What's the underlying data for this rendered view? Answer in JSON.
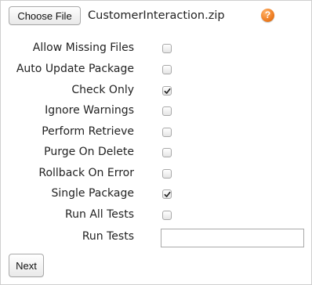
{
  "upload": {
    "choose_file_label": "Choose File",
    "file_name": "CustomerInteraction.zip",
    "help_glyph": "?"
  },
  "options": [
    {
      "label": "Allow Missing Files",
      "checked": false
    },
    {
      "label": "Auto Update Package",
      "checked": false
    },
    {
      "label": "Check Only",
      "checked": true
    },
    {
      "label": "Ignore Warnings",
      "checked": false
    },
    {
      "label": "Perform Retrieve",
      "checked": false
    },
    {
      "label": "Purge On Delete",
      "checked": false
    },
    {
      "label": "Rollback On Error",
      "checked": false
    },
    {
      "label": "Single Package",
      "checked": true
    },
    {
      "label": "Run All Tests",
      "checked": false
    }
  ],
  "run_tests": {
    "label": "Run Tests",
    "value": ""
  },
  "actions": {
    "next_label": "Next"
  },
  "colors": {
    "help_icon": "#ef7e22",
    "checkmark": "#222222"
  },
  "icons": {
    "help": "question-mark-circle-icon",
    "check": "checkmark-icon"
  }
}
